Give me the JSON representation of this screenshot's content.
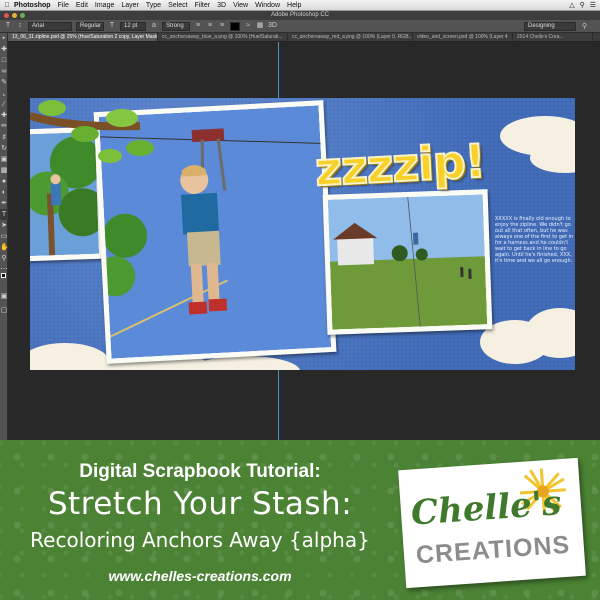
{
  "menubar": {
    "app": "Photoshop",
    "items": [
      "File",
      "Edit",
      "Image",
      "Layer",
      "Type",
      "Select",
      "Filter",
      "3D",
      "View",
      "Window",
      "Help"
    ]
  },
  "window": {
    "title": "Adobe Photoshop CC"
  },
  "options_bar": {
    "font_family": "Arial",
    "font_style": "Regular",
    "font_size": "12 pt",
    "antialias": "Strong",
    "workspace": "Designing"
  },
  "tabs": [
    "13_06_11 zipline.psd @ 25% (Hue/Saturation 2 copy, Layer Mask/8) *",
    "cc_anchorsaway_blue_a.png @ 100% (Hue/Saturati...",
    "cc_anchorsaway_red_a.png @ 100% (Layer 0, RGB...",
    "video_and_screen.psd @ 100% (Layer 4",
    "2014 Chelle's Crea..."
  ],
  "scrapbook": {
    "title": "zzzzip!",
    "journal": "XXXXX is finally old enough to enjoy the zipline. We didn't go out all that often, but he was always one of the first to get in for a harness and he couldn't wait to get back in line to go again. Until he's finished, XXX, it's time and we all go enough."
  },
  "banner": {
    "line1": "Digital Scrapbook Tutorial:",
    "line2": "Stretch Your Stash:",
    "line3": "Recoloring Anchors Away {alpha}",
    "url": "www.chelles-creations.com"
  },
  "logo": {
    "script": "Chelle's",
    "word": "CREATIONS"
  },
  "colors": {
    "banner_green": "#4b8234",
    "scrap_blue": "#4a74bf",
    "title_yellow": "#f7d028",
    "guide": "#4fb9ff"
  }
}
